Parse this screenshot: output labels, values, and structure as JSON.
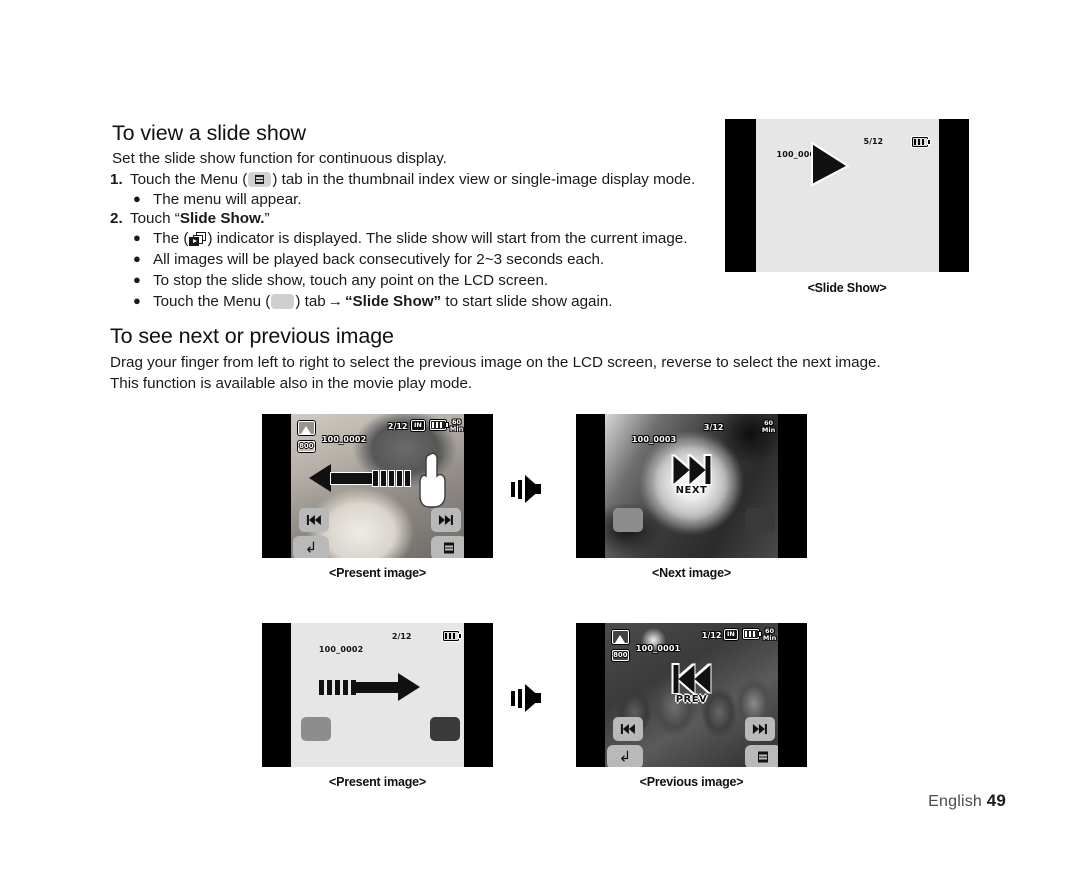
{
  "sections": {
    "slide_show": {
      "heading": "To view a slide show",
      "intro": "Set the slide show function for continuous display.",
      "steps": [
        {
          "num": "1.",
          "text_before": "Touch the Menu (",
          "icon": "menu-tab-icon",
          "text_after": ") tab in the thumbnail index view or single-image display mode."
        },
        {
          "num": "2.",
          "text_before": "Touch “",
          "bold": "Slide Show.",
          "text_after": "”"
        }
      ],
      "bullets": {
        "menu_appear": "The menu will appear.",
        "indicator_before": "The (",
        "indicator_icon": "slide-show-indicator-icon",
        "indicator_after": ") indicator is displayed. The slide show will start from the current image.",
        "consecutive": "All images will be played back consecutively for 2~3 seconds each.",
        "stop": "To stop the slide show, touch any point on the LCD screen.",
        "again_before": "Touch the Menu (",
        "again_icon": "blank-menu-tab-icon",
        "again_mid": ") tab",
        "again_arrow": "→",
        "again_bold": "“Slide Show”",
        "again_after": "to start slide show again."
      }
    },
    "next_prev": {
      "heading": "To see next or previous image",
      "para1": "Drag your finger from left to right to select the previous image on the LCD screen, reverse to select the next image.",
      "para2": "This function is available also in the movie play mode."
    }
  },
  "figures": {
    "slide_show": {
      "caption": "<Slide Show>",
      "scene": "plain-gray",
      "osd": {
        "filename": "100_0005",
        "counter": "5/12",
        "battery": "battery-icon"
      },
      "cursor": "play-cursor-arrow"
    },
    "present_top": {
      "caption": "<Present image>",
      "scene": "two-puppies-photo",
      "osd": {
        "photo_mode": "photo-mode-icon",
        "resolution": "800",
        "filename": "100_0002",
        "counter": "2/12",
        "memory": "IN",
        "battery": "battery-icon",
        "record_time": "60\nMin"
      },
      "gesture": "drag-left-arrow",
      "hand": "finger-icon",
      "buttons": {
        "prev": "skip-prev-icon",
        "next": "skip-next-icon",
        "back": "back-arrow-icon",
        "menu": "menu-icon"
      }
    },
    "next_image": {
      "caption": "<Next image>",
      "scene": "dandelion-photo",
      "osd": {
        "filename": "100_0003",
        "counter": "3/12",
        "record_time_line1": "60",
        "record_time_line2": "Min"
      },
      "overlay_label": "NEXT",
      "overlay_icon": "skip-next-big-icon"
    },
    "present_bottom": {
      "caption": "<Present image>",
      "scene": "plain-gray",
      "osd": {
        "filename": "100_0002",
        "counter": "2/12",
        "battery": "battery-icon"
      },
      "gesture": "drag-right-arrow"
    },
    "previous_image": {
      "caption": "<Previous image>",
      "scene": "berries-photo",
      "osd": {
        "photo_mode": "photo-mode-icon",
        "resolution": "800",
        "filename": "100_0001",
        "counter": "1/12",
        "memory": "IN",
        "battery": "battery-icon",
        "record_time_line1": "60",
        "record_time_line2": "Min"
      },
      "overlay_label": "PREV",
      "overlay_icon": "skip-prev-big-icon",
      "buttons": {
        "prev": "skip-prev-icon",
        "next": "skip-next-icon",
        "back": "back-arrow-icon",
        "menu": "menu-icon"
      }
    },
    "transition_arrow": "transition-arrow-icon"
  },
  "footer": {
    "language": "English ",
    "page": "49"
  },
  "colors": {
    "text": "#1a1a1a",
    "bezel": "#000000",
    "screen_plain": "#e6e6e6",
    "button": "#b9b9b9",
    "chip": "#d2d2d2"
  }
}
